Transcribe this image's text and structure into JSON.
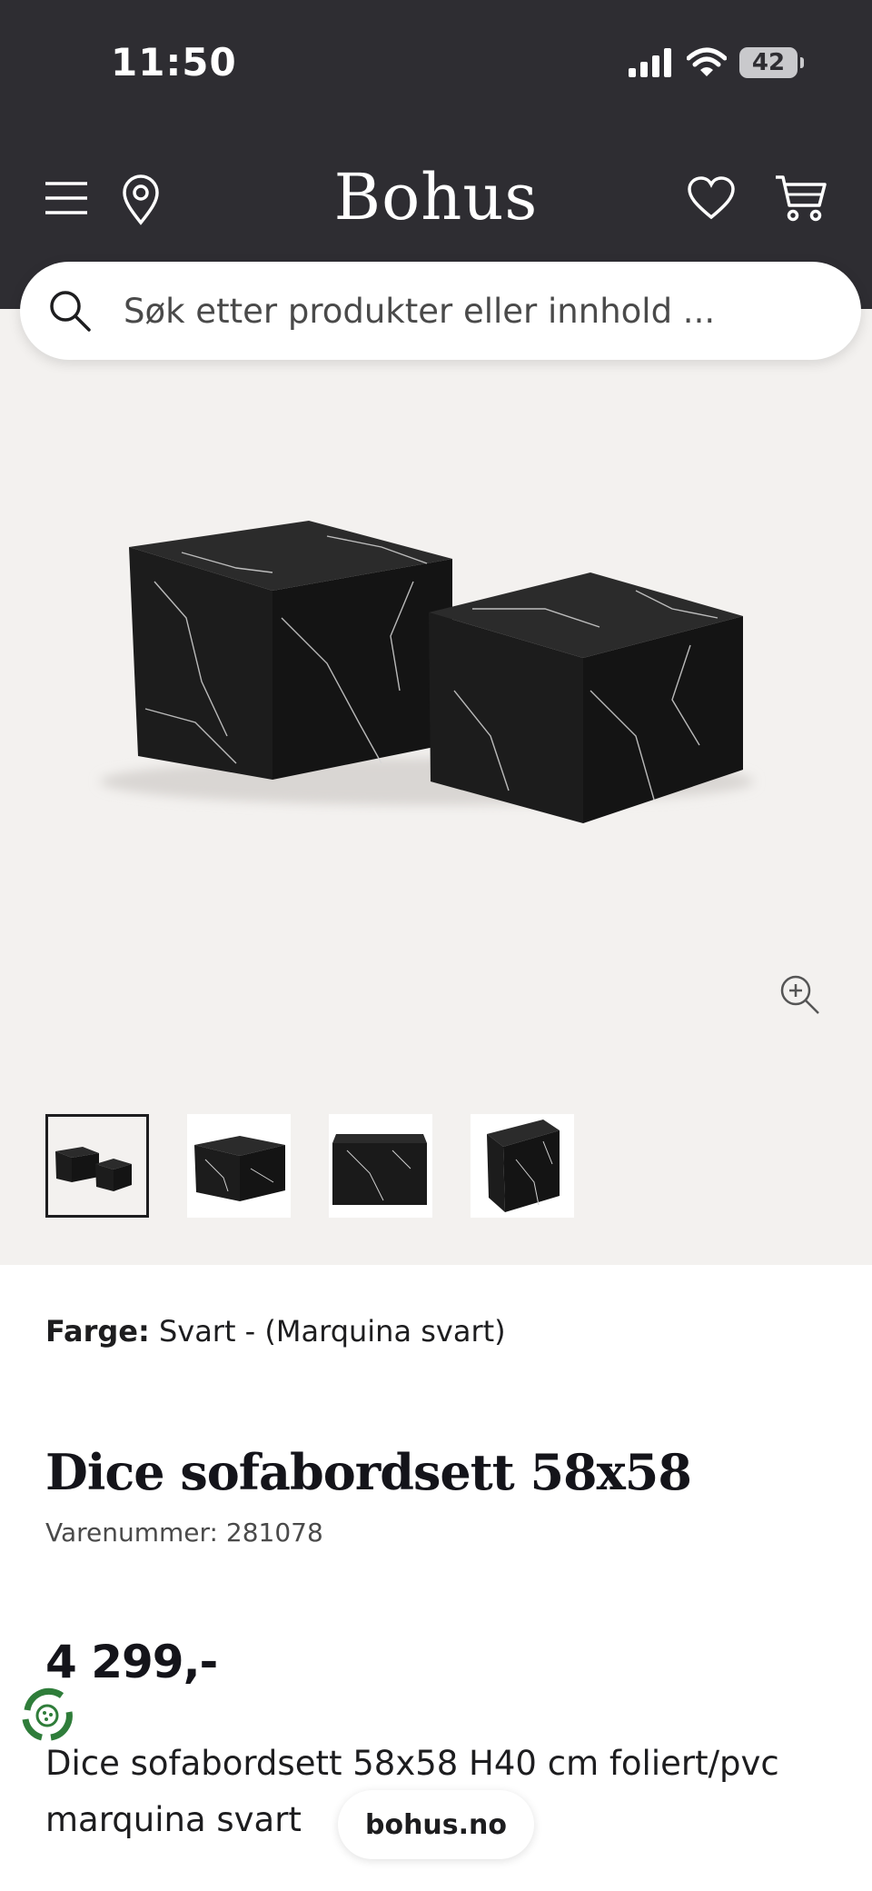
{
  "status_bar": {
    "time": "11:50",
    "battery": "42"
  },
  "header": {
    "logo": "Bohus",
    "icons": [
      "menu-icon",
      "location-pin-icon",
      "heart-icon",
      "cart-icon"
    ]
  },
  "search": {
    "placeholder": "Søk etter produkter eller innhold ..."
  },
  "gallery": {
    "thumbnails": [
      "thumbnail-1",
      "thumbnail-2",
      "thumbnail-3",
      "thumbnail-4"
    ],
    "active_thumbnail": 0
  },
  "product": {
    "color_label": "Farge:",
    "color_value": "Svart - (Marquina svart)",
    "title": "Dice sofabordsett 58x58",
    "sku": "Varenummer: 281078",
    "price": "4 299,-",
    "description": "Dice sofabordsett 58x58 H40 cm foliert/pvc marquina svart"
  },
  "browser": {
    "url": "bohus.no"
  },
  "colors": {
    "header_bg": "#2e2d32",
    "gallery_bg": "#f3f1ef",
    "eco_green": "#2f7d3a"
  }
}
